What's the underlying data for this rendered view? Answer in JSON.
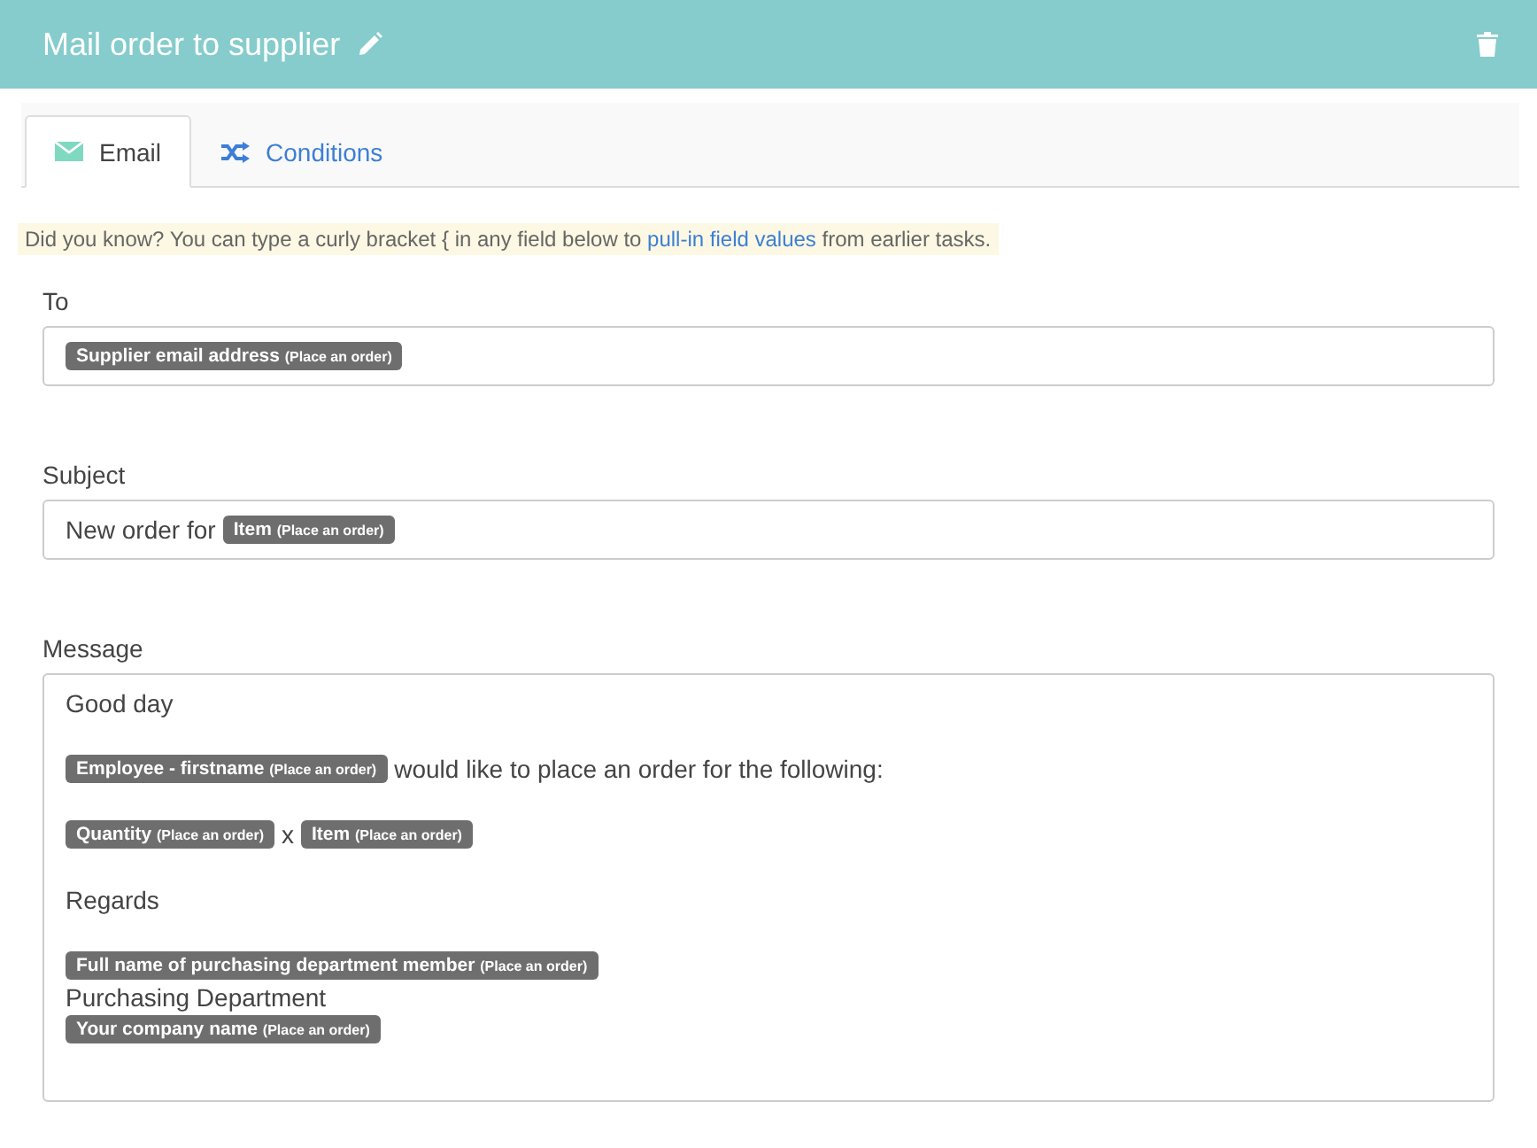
{
  "header": {
    "title": "Mail order to supplier"
  },
  "tabs": [
    {
      "label": "Email",
      "selected": true
    },
    {
      "label": "Conditions",
      "selected": false
    }
  ],
  "hint": {
    "before": "Did you know? You can type a curly bracket { in any field below to",
    "link": "pull-in field values",
    "after": "from earlier tasks."
  },
  "fields": [
    {
      "label": "To",
      "paragraphs": [
        {
          "lines": [
            [
              {
                "kind": "tag",
                "name": "Supplier email address",
                "source": "(Place an order)"
              }
            ]
          ]
        }
      ]
    },
    {
      "label": "Subject",
      "paragraphs": [
        {
          "lines": [
            [
              {
                "kind": "text",
                "text": "New order for"
              },
              {
                "kind": "tag",
                "name": "Item",
                "source": "(Place an order)"
              }
            ]
          ]
        }
      ]
    },
    {
      "label": "Message",
      "paragraphs": [
        {
          "lines": [
            [
              {
                "kind": "text",
                "text": "Good day"
              }
            ]
          ]
        },
        {
          "lines": [
            [
              {
                "kind": "tag",
                "name": "Employee - firstname",
                "source": "(Place an order)"
              },
              {
                "kind": "text",
                "text": "would like to place an order for the following:"
              }
            ]
          ]
        },
        {
          "lines": [
            [
              {
                "kind": "tag",
                "name": "Quantity",
                "source": "(Place an order)"
              },
              {
                "kind": "text",
                "text": "x"
              },
              {
                "kind": "tag",
                "name": "Item",
                "source": "(Place an order)"
              }
            ]
          ]
        },
        {
          "lines": [
            [
              {
                "kind": "text",
                "text": "Regards"
              }
            ]
          ]
        },
        {
          "lines": [
            [
              {
                "kind": "tag",
                "name": "Full name of purchasing department member",
                "source": "(Place an order)"
              }
            ],
            [
              {
                "kind": "text",
                "text": "Purchasing Department"
              }
            ],
            [
              {
                "kind": "tag",
                "name": "Your company name",
                "source": "(Place an order)"
              }
            ]
          ]
        }
      ]
    }
  ]
}
